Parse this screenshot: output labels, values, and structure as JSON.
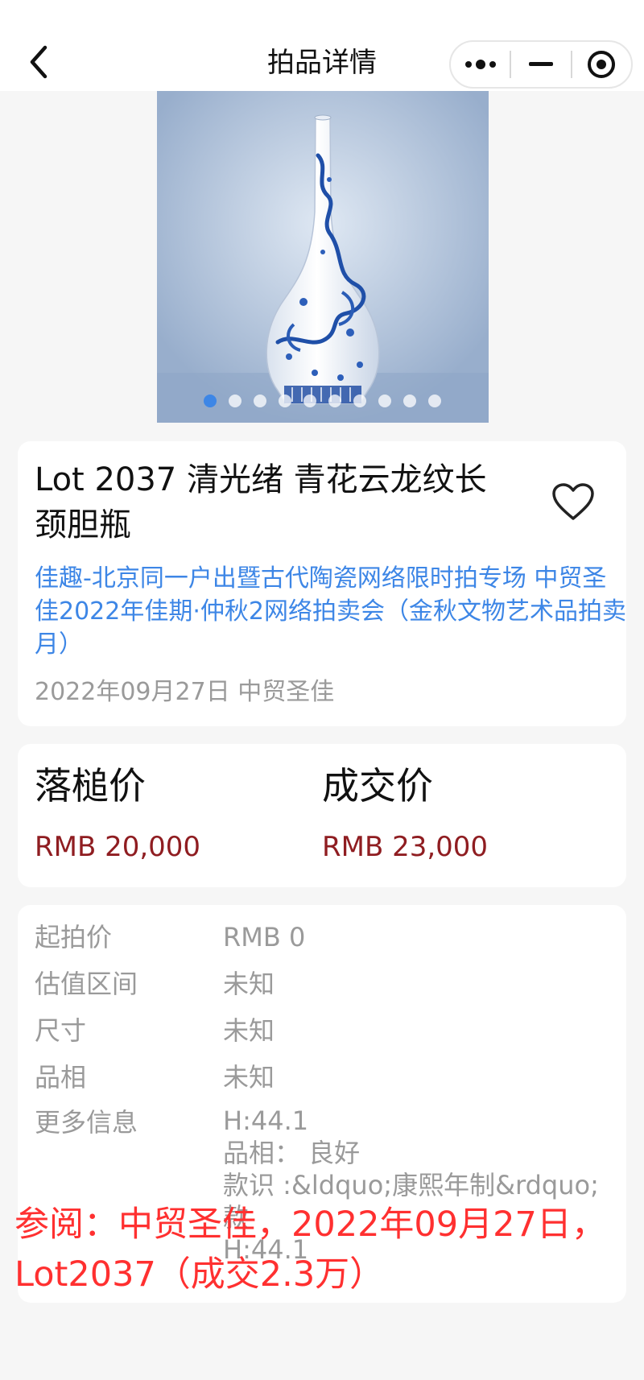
{
  "nav": {
    "title": "拍品详情",
    "back_icon": "chevron-left-icon",
    "capsule": [
      "more-dots-icon",
      "minimize-icon",
      "record-target-icon"
    ]
  },
  "gallery": {
    "image": "blue-and-white-dragon-vase",
    "dot_count": 10,
    "active_index": 0
  },
  "lot": {
    "title": "Lot 2037 清光绪 青花云龙纹长颈胆瓶",
    "session": "佳趣-北京同一户出暨古代陶瓷网络限时拍专场 中贸圣佳2022年佳期·仲秋2网络拍卖会（金秋文物艺术品拍卖月）",
    "date_house": "2022年09月27日 中贸圣佳",
    "favorite_icon": "heart-outline-icon"
  },
  "prices": {
    "hammer_label": "落槌价",
    "hammer_value": "RMB 20,000",
    "deal_label": "成交价",
    "deal_value": "RMB 23,000"
  },
  "details": {
    "start_label": "起拍价",
    "start_value": "RMB 0",
    "estimate_label": "估值区间",
    "estimate_value": "未知",
    "size_label": "尺寸",
    "size_value": "未知",
    "condition_label": "品相",
    "condition_value": "未知",
    "more_label": "更多信息",
    "more_line1": "H:44.1",
    "more_line2": "品相： 良好",
    "more_line3": "款识 :&ldquo;康熙年制&rdquo;",
    "more_line4": "款",
    "more_line5": "H:44.1"
  },
  "watermark": {
    "text": "参阅：中贸圣佳，2022年09月27日，Lot2037（成交2.3万）"
  },
  "colors": {
    "link": "#3d86e6",
    "price": "#8f1d21",
    "watermark": "#ff3030",
    "secondary_text": "#9a9a9a"
  }
}
